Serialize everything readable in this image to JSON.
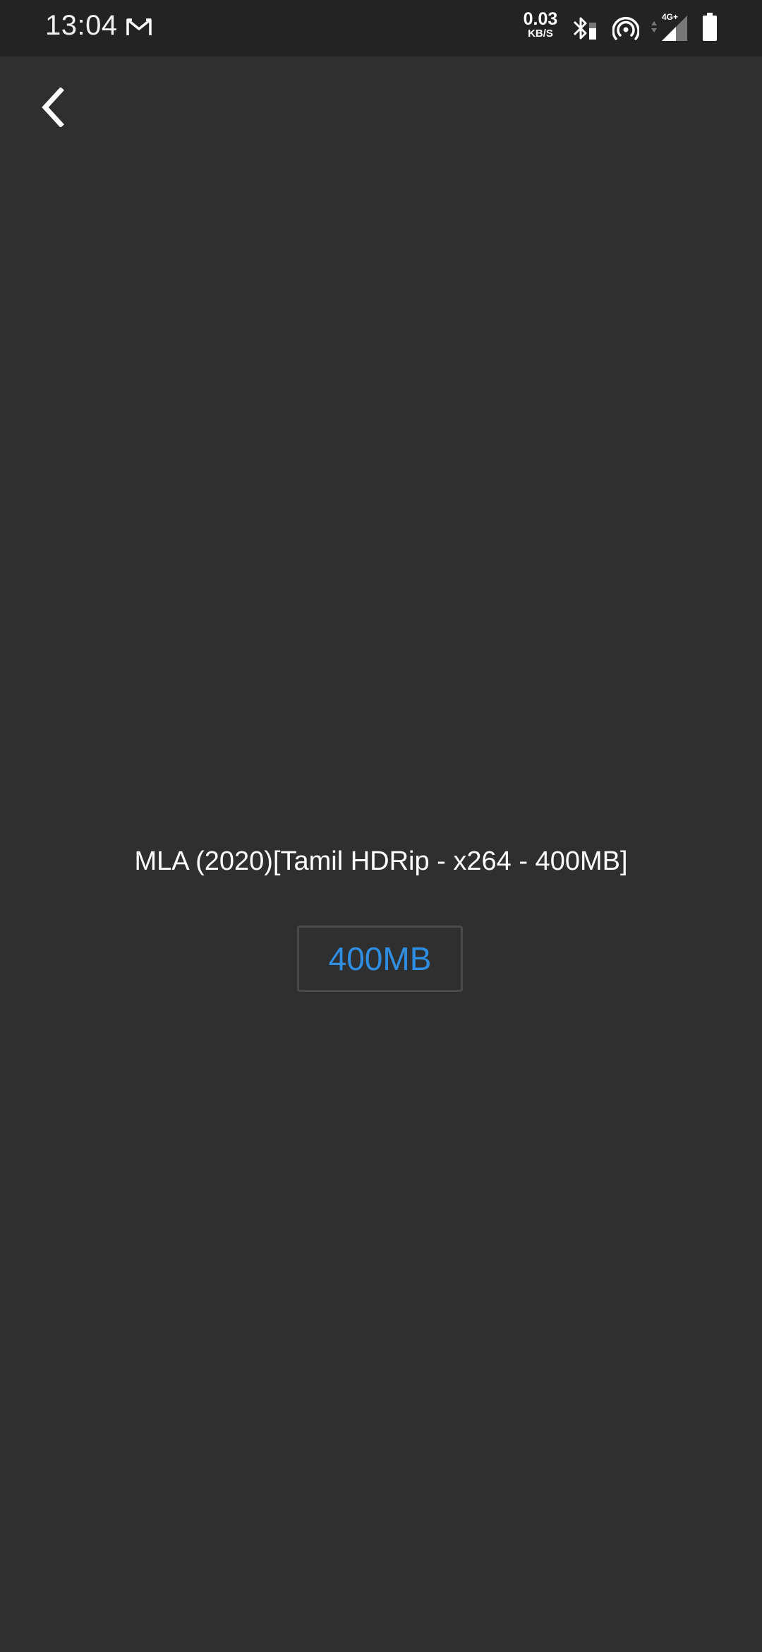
{
  "status_bar": {
    "time": "13:04",
    "net_speed_value": "0.03",
    "net_speed_unit": "KB/S",
    "network_type": "4G+",
    "notification_icon": "gmail-icon"
  },
  "header": {
    "back_icon": "chevron-left-icon"
  },
  "content": {
    "title": "MLA (2020)[Tamil HDRip - x264 - 400MB]",
    "size_button_label": "400MB"
  },
  "colors": {
    "background": "#2f2f2f",
    "status_bar": "#232323",
    "accent": "#2f8ee2",
    "button_border": "#4a4a4a",
    "text": "#ffffff"
  }
}
